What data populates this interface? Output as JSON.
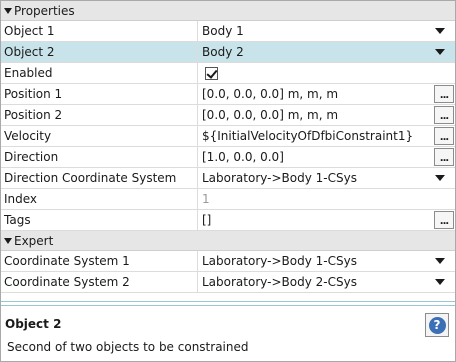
{
  "sections": {
    "properties": "Properties",
    "expert": "Expert"
  },
  "rows": {
    "object1": {
      "label": "Object 1",
      "value": "Body 1"
    },
    "object2": {
      "label": "Object 2",
      "value": "Body 2"
    },
    "enabled": {
      "label": "Enabled",
      "checked": true
    },
    "position1": {
      "label": "Position 1",
      "value": "[0.0, 0.0, 0.0] m, m, m"
    },
    "position2": {
      "label": "Position 2",
      "value": "[0.0, 0.0, 0.0] m, m, m"
    },
    "velocity": {
      "label": "Velocity",
      "value": "${InitialVelocityOfDfbiConstraint1}"
    },
    "direction": {
      "label": "Direction",
      "value": "[1.0, 0.0, 0.0]"
    },
    "direction_cs": {
      "label": "Direction Coordinate System",
      "value": "Laboratory->Body 1-CSys"
    },
    "index": {
      "label": "Index",
      "value": "1"
    },
    "tags": {
      "label": "Tags",
      "value": "[]"
    },
    "cs1": {
      "label": "Coordinate System 1",
      "value": "Laboratory->Body 1-CSys"
    },
    "cs2": {
      "label": "Coordinate System 2",
      "value": "Laboratory->Body 2-CSys"
    }
  },
  "ellipsis_label": "...",
  "description": {
    "title": "Object 2",
    "text": "Second of two objects to be constrained",
    "help_symbol": "?"
  },
  "colors": {
    "selected_row": "#c9e3ea",
    "section_header": "#e6e6e6",
    "help_icon": "#3b6fb6"
  },
  "icons": {
    "section_toggle": "triangle-down-icon",
    "dropdown": "chevron-down-icon",
    "checkbox": "checkmark-icon",
    "help": "question-circle-icon"
  }
}
